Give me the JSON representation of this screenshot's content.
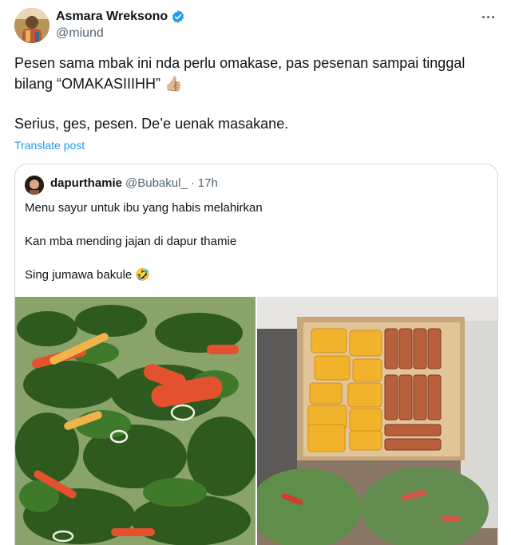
{
  "post": {
    "display_name": "Asmara Wreksono",
    "handle": "@miund",
    "lines": [
      "Pesen sama mbak ini nda perlu omakase, pas pesenan sampai tinggal",
      "bilang “OMAKASIIIHH”"
    ],
    "thumb_emoji": "👍🏼",
    "line2": "Serius, ges, pesen. De’e uenak masakane.",
    "translate_label": "Translate post",
    "verified_icon": "verified-badge-icon",
    "more_icon": "more-dots-icon",
    "accent_color": "#1d9bf0"
  },
  "quote": {
    "display_name": "dapurthamie",
    "handle": "@Bubakul_",
    "separator": "·",
    "time": "17h",
    "lines": [
      "Menu sayur untuk ibu yang habis melahirkan",
      "Kan mba mending jajan di dapur thamie",
      "Sing jumawa bakule 🤣"
    ],
    "media": [
      "vegetable-soup-photo",
      "tofu-tempeh-box-photo"
    ]
  }
}
